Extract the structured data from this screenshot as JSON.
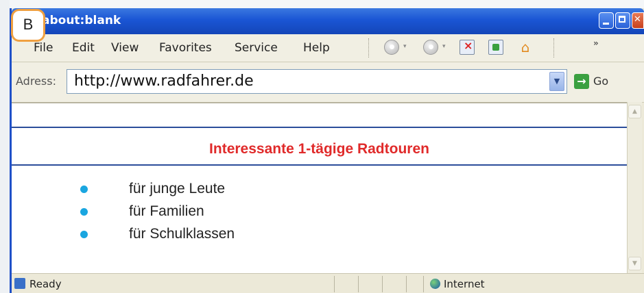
{
  "badge": "B",
  "window": {
    "title": "about:blank"
  },
  "menu": [
    "File",
    "Edit",
    "View",
    "Favorites",
    "Service",
    "Help"
  ],
  "toolbar": {
    "overflow": "»"
  },
  "address": {
    "label": "Adress:",
    "value": "http://www.radfahrer.de",
    "go_label": "Go"
  },
  "page": {
    "heading": "Interessante 1-tägige Radtouren",
    "items": [
      "für junge Leute",
      "für Familien",
      "für Schulklassen"
    ]
  },
  "status": {
    "text": "Ready",
    "zone": "Internet"
  },
  "colors": {
    "title_bar": "#1a55d4",
    "heading": "#e02a2a",
    "bullet": "#1aa6e0",
    "rule": "#2b4d9a"
  }
}
